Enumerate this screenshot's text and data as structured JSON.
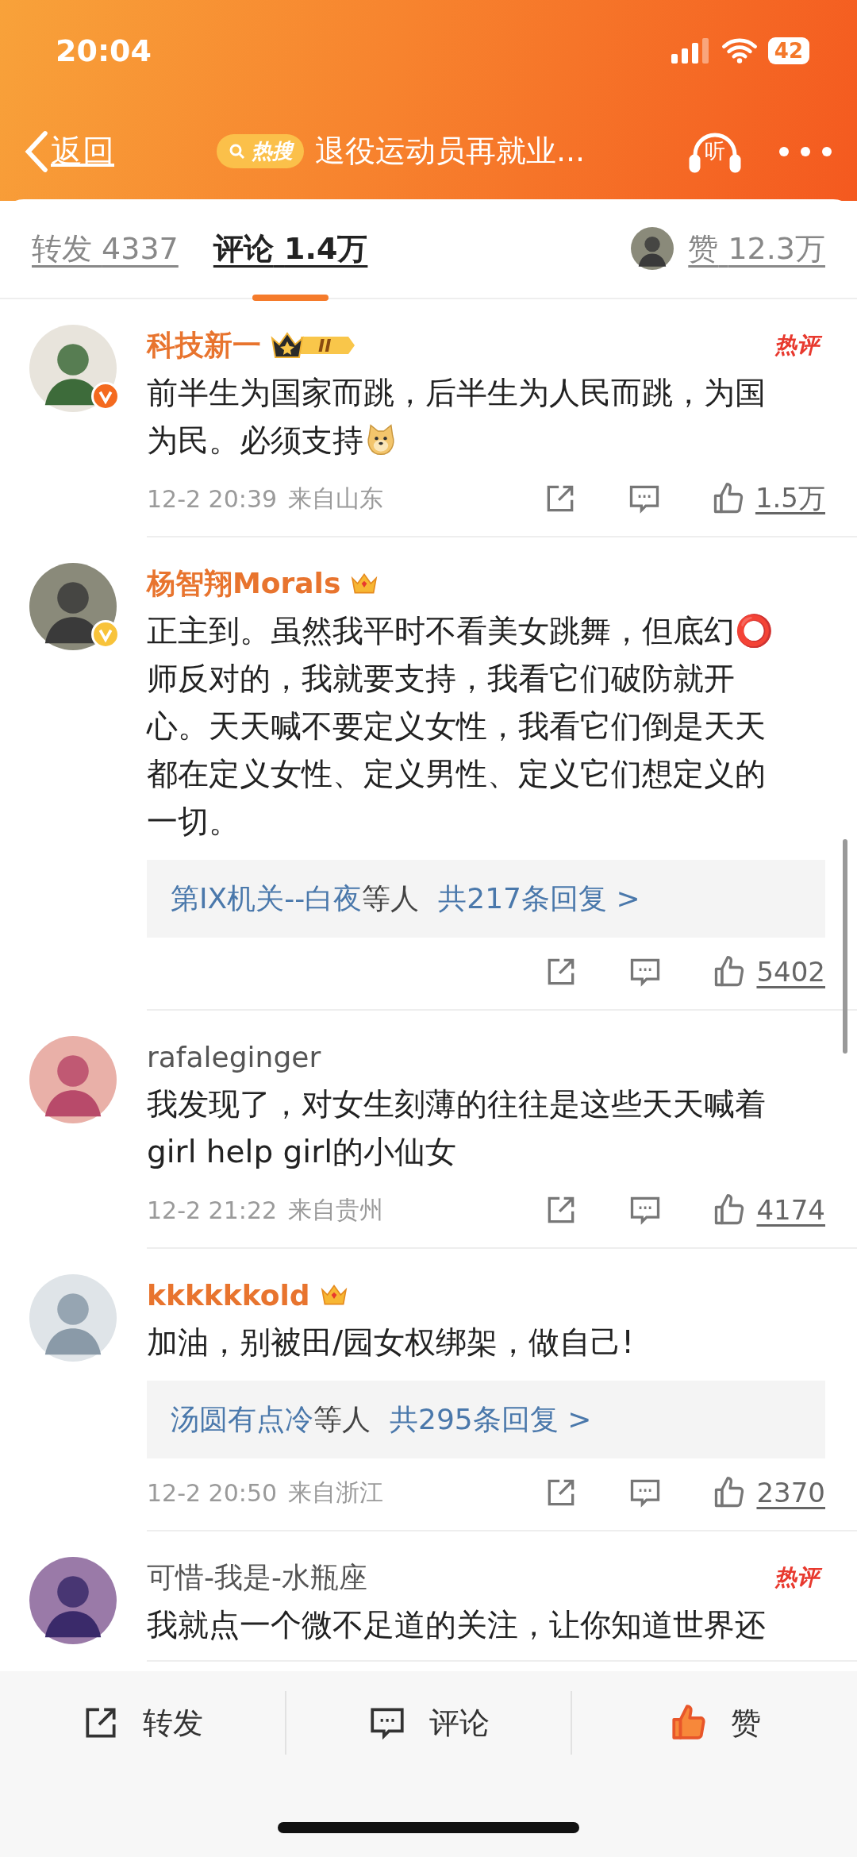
{
  "status_bar": {
    "time": "20:04",
    "battery": "42"
  },
  "nav": {
    "back": "返回",
    "hot_tag": "热搜",
    "title": "退役运动员再就业...",
    "listen": "听"
  },
  "tabs": [
    {
      "label": "转发",
      "count": "4337",
      "selected": false
    },
    {
      "label": "评论",
      "count": "1.4万",
      "selected": true
    }
  ],
  "likes_tab": {
    "label": "赞",
    "count": "12.3万"
  },
  "comments": [
    {
      "name": "科技新一",
      "vip": true,
      "badge": {
        "kind": "crown_level",
        "text": "II"
      },
      "verified": {
        "color": "#f46a1f"
      },
      "hot_label": "热评",
      "text": "前半生为国家而跳，后半生为人民而跳，为国为民。必须支持",
      "emoji": {
        "kind": "doge"
      },
      "time": "12-2 20:39",
      "location": "来自山东",
      "likes": "1.5万"
    },
    {
      "name": "杨智翔Morals",
      "vip": true,
      "badge": {
        "kind": "crown"
      },
      "verified": {
        "color": "#f8c33a"
      },
      "text": "正主到。虽然我平时不看美女跳舞，但底幻⭕师反对的，我就要支持，我看它们破防就开心。天天喊不要定义女性，我看它们倒是天天都在定义女性、定义男性、定义它们想定义的一切。",
      "replies": {
        "names": "第IX机关--白夜",
        "suffix": "等人",
        "count": "共217条回复 >"
      },
      "likes": "5402"
    },
    {
      "name": "rafaleginger",
      "vip": false,
      "text": "我发现了，对女生刻薄的往往是这些天天喊着girl help girl的小仙女",
      "time": "12-2 21:22",
      "location": "来自贵州",
      "likes": "4174"
    },
    {
      "name": "kkkkkkold",
      "vip": true,
      "badge": {
        "kind": "crown"
      },
      "text": "加油，别被田/园女权绑架，做自己!",
      "replies": {
        "names": "汤圆有点冷",
        "suffix": "等人",
        "count": "共295条回复 >"
      },
      "time": "12-2 20:50",
      "location": "来自浙江",
      "likes": "2370"
    },
    {
      "name": "可惜-我是-水瓶座",
      "vip": false,
      "hot_label": "热评",
      "text": "我就点一个微不足道的关注，让你知道世界还"
    }
  ],
  "bottom_bar": [
    {
      "kind": "repost",
      "label": "转发",
      "active": false
    },
    {
      "kind": "comment",
      "label": "评论",
      "active": false
    },
    {
      "kind": "like",
      "label": "赞",
      "active": true
    }
  ]
}
